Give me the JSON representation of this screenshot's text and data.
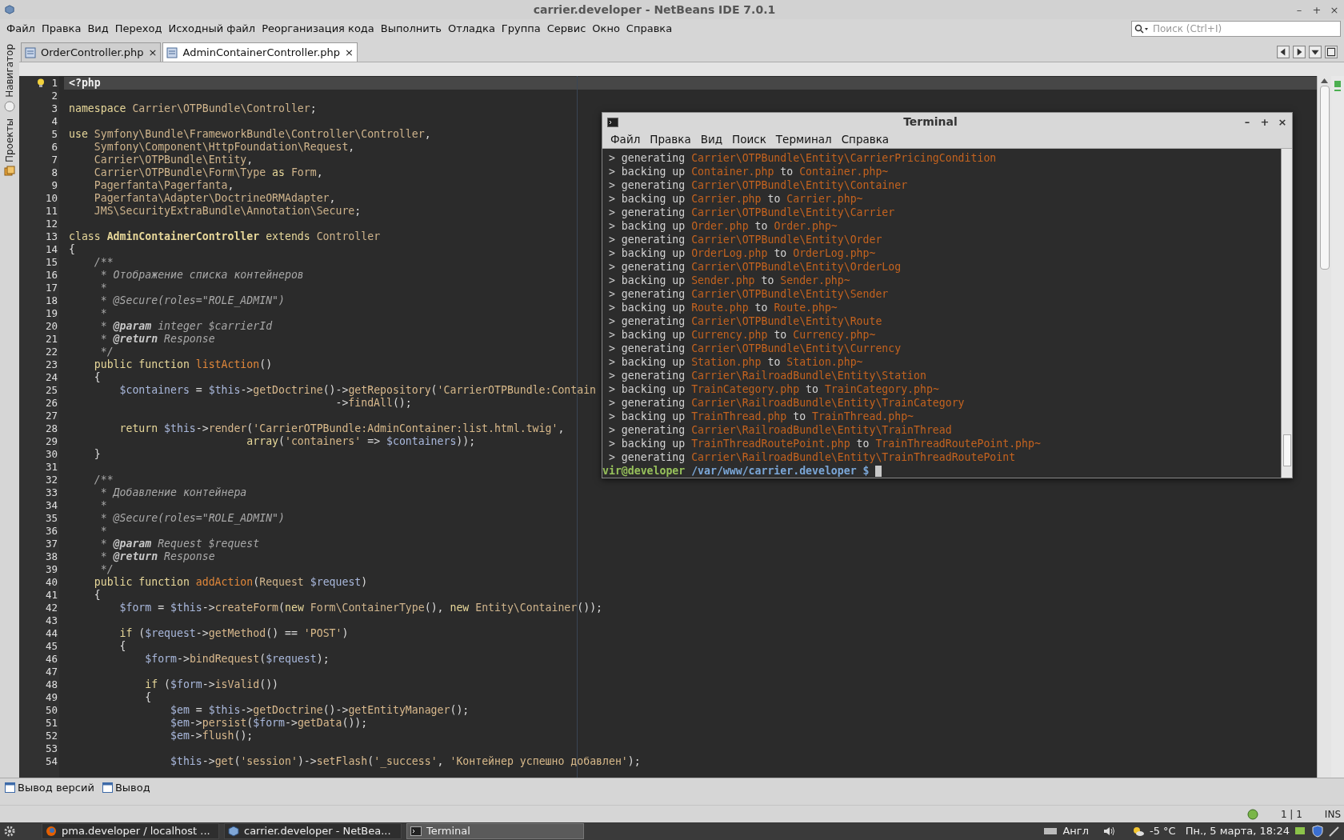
{
  "window": {
    "title": "carrier.developer - NetBeans IDE 7.0.1",
    "controls": [
      "–",
      "+",
      "×"
    ]
  },
  "menu": [
    "Файл",
    "Правка",
    "Вид",
    "Переход",
    "Исходный файл",
    "Реорганизация кода",
    "Выполнить",
    "Отладка",
    "Группа",
    "Сервис",
    "Окно",
    "Справка"
  ],
  "search": {
    "placeholder": "Поиск (Ctrl+I)"
  },
  "tabs": [
    {
      "label": "OrderController.php",
      "selected": false,
      "close": "×"
    },
    {
      "label": "AdminContainerController.php",
      "selected": true,
      "close": "×"
    }
  ],
  "side_panels": [
    "Навигатор",
    "Проекты"
  ],
  "editor": {
    "lines": [
      {
        "n": "1",
        "current": true,
        "tokens": [
          {
            "kind": "php",
            "text": "<?php"
          }
        ]
      },
      {
        "n": "2",
        "current": false
      },
      {
        "n": "3",
        "current": false,
        "tokens": [
          {
            "kind": "kw",
            "text": "namespace "
          },
          {
            "kind": "ns",
            "text": "Carrier\\OTPBundle\\Controller"
          },
          {
            "kind": "pl",
            "text": ";"
          }
        ]
      },
      {
        "n": "4",
        "current": false
      },
      {
        "n": "5",
        "current": false,
        "tokens": [
          {
            "kind": "kw",
            "text": "use "
          },
          {
            "kind": "ns",
            "text": "Symfony\\Bundle\\FrameworkBundle\\Controller\\Controller"
          },
          {
            "kind": "pl",
            "text": ","
          }
        ]
      },
      {
        "n": "6",
        "current": false,
        "tokens": [
          {
            "kind": "ns",
            "text": "    Symfony\\Component\\HttpFoundation\\Request"
          },
          {
            "kind": "pl",
            "text": ","
          }
        ]
      },
      {
        "n": "7",
        "current": false,
        "tokens": [
          {
            "kind": "ns",
            "text": "    Carrier\\OTPBundle\\Entity"
          },
          {
            "kind": "pl",
            "text": ","
          }
        ]
      },
      {
        "n": "8",
        "current": false,
        "tokens": [
          {
            "kind": "ns",
            "text": "    Carrier\\OTPBundle\\Form\\Type"
          },
          {
            "kind": "kw",
            "text": " as "
          },
          {
            "kind": "ns",
            "text": "Form"
          },
          {
            "kind": "pl",
            "text": ","
          }
        ]
      },
      {
        "n": "9",
        "current": false,
        "tokens": [
          {
            "kind": "ns",
            "text": "    Pagerfanta\\Pagerfanta"
          },
          {
            "kind": "pl",
            "text": ","
          }
        ]
      },
      {
        "n": "10",
        "current": false,
        "tokens": [
          {
            "kind": "ns",
            "text": "    Pagerfanta\\Adapter\\DoctrineORMAdapter"
          },
          {
            "kind": "pl",
            "text": ","
          }
        ]
      },
      {
        "n": "11",
        "current": false,
        "tokens": [
          {
            "kind": "ns",
            "text": "    JMS\\SecurityExtraBundle\\Annotation\\Secure"
          },
          {
            "kind": "pl",
            "text": ";"
          }
        ]
      },
      {
        "n": "12",
        "current": false
      },
      {
        "n": "13",
        "current": false,
        "tokens": [
          {
            "kind": "kw",
            "text": "class "
          },
          {
            "kind": "cls",
            "text": "AdminContainerController"
          },
          {
            "kind": "kw",
            "text": " extends "
          },
          {
            "kind": "ns",
            "text": "Controller"
          }
        ]
      },
      {
        "n": "14",
        "current": false,
        "tokens": [
          {
            "kind": "pl",
            "text": "{"
          }
        ]
      },
      {
        "n": "15",
        "current": false,
        "tokens": [
          {
            "kind": "cm",
            "text": "    /**"
          }
        ]
      },
      {
        "n": "16",
        "current": false,
        "tokens": [
          {
            "kind": "cm",
            "text": "     * Отображение списка контейнеров"
          }
        ]
      },
      {
        "n": "17",
        "current": false,
        "tokens": [
          {
            "kind": "cm",
            "text": "     *"
          }
        ]
      },
      {
        "n": "18",
        "current": false,
        "tokens": [
          {
            "kind": "cm",
            "text": "     * @Secure(roles=\"ROLE_ADMIN\")"
          }
        ]
      },
      {
        "n": "19",
        "current": false,
        "tokens": [
          {
            "kind": "cm",
            "text": "     *"
          }
        ]
      },
      {
        "n": "20",
        "current": false,
        "tokens": [
          {
            "kind": "cm",
            "text": "     * "
          },
          {
            "kind": "tag",
            "text": "@param"
          },
          {
            "kind": "cm",
            "text": " integer $carrierId"
          }
        ]
      },
      {
        "n": "21",
        "current": false,
        "tokens": [
          {
            "kind": "cm",
            "text": "     * "
          },
          {
            "kind": "tag",
            "text": "@return"
          },
          {
            "kind": "cm",
            "text": " Response"
          }
        ]
      },
      {
        "n": "22",
        "current": false,
        "tokens": [
          {
            "kind": "cm",
            "text": "     */"
          }
        ]
      },
      {
        "n": "23",
        "current": false,
        "tokens": [
          {
            "kind": "kw",
            "text": "    public function "
          },
          {
            "kind": "def",
            "text": "listAction"
          },
          {
            "kind": "pl",
            "text": "()"
          }
        ]
      },
      {
        "n": "24",
        "current": false,
        "tokens": [
          {
            "kind": "pl",
            "text": "    {"
          }
        ]
      },
      {
        "n": "25",
        "current": false,
        "tokens": [
          {
            "kind": "var",
            "text": "        $containers"
          },
          {
            "kind": "pl",
            "text": " = "
          },
          {
            "kind": "var",
            "text": "$this"
          },
          {
            "kind": "pl",
            "text": "->"
          },
          {
            "kind": "fn",
            "text": "getDoctrine"
          },
          {
            "kind": "pl",
            "text": "()->"
          },
          {
            "kind": "fn",
            "text": "getRepository"
          },
          {
            "kind": "pl",
            "text": "("
          },
          {
            "kind": "str",
            "text": "'CarrierOTPBundle:Contain"
          }
        ]
      },
      {
        "n": "26",
        "current": false,
        "tokens": [
          {
            "kind": "pl",
            "text": "                                          ->"
          },
          {
            "kind": "fn",
            "text": "findAll"
          },
          {
            "kind": "pl",
            "text": "();"
          }
        ]
      },
      {
        "n": "27",
        "current": false
      },
      {
        "n": "28",
        "current": false,
        "tokens": [
          {
            "kind": "kw",
            "text": "        return "
          },
          {
            "kind": "var",
            "text": "$this"
          },
          {
            "kind": "pl",
            "text": "->"
          },
          {
            "kind": "fn",
            "text": "render"
          },
          {
            "kind": "pl",
            "text": "("
          },
          {
            "kind": "str",
            "text": "'CarrierOTPBundle:AdminContainer:list.html.twig'"
          },
          {
            "kind": "pl",
            "text": ","
          }
        ]
      },
      {
        "n": "29",
        "current": false,
        "tokens": [
          {
            "kind": "kw",
            "text": "                            array"
          },
          {
            "kind": "pl",
            "text": "("
          },
          {
            "kind": "str",
            "text": "'containers'"
          },
          {
            "kind": "pl",
            "text": " => "
          },
          {
            "kind": "var",
            "text": "$containers"
          },
          {
            "kind": "pl",
            "text": "));"
          }
        ]
      },
      {
        "n": "30",
        "current": false,
        "tokens": [
          {
            "kind": "pl",
            "text": "    }"
          }
        ]
      },
      {
        "n": "31",
        "current": false
      },
      {
        "n": "32",
        "current": false,
        "tokens": [
          {
            "kind": "cm",
            "text": "    /**"
          }
        ]
      },
      {
        "n": "33",
        "current": false,
        "tokens": [
          {
            "kind": "cm",
            "text": "     * Добавление контейнера"
          }
        ]
      },
      {
        "n": "34",
        "current": false,
        "tokens": [
          {
            "kind": "cm",
            "text": "     *"
          }
        ]
      },
      {
        "n": "35",
        "current": false,
        "tokens": [
          {
            "kind": "cm",
            "text": "     * @Secure(roles=\"ROLE_ADMIN\")"
          }
        ]
      },
      {
        "n": "36",
        "current": false,
        "tokens": [
          {
            "kind": "cm",
            "text": "     *"
          }
        ]
      },
      {
        "n": "37",
        "current": false,
        "tokens": [
          {
            "kind": "cm",
            "text": "     * "
          },
          {
            "kind": "tag",
            "text": "@param"
          },
          {
            "kind": "cm",
            "text": " Request $request"
          }
        ]
      },
      {
        "n": "38",
        "current": false,
        "tokens": [
          {
            "kind": "cm",
            "text": "     * "
          },
          {
            "kind": "tag",
            "text": "@return"
          },
          {
            "kind": "cm",
            "text": " Response"
          }
        ]
      },
      {
        "n": "39",
        "current": false,
        "tokens": [
          {
            "kind": "cm",
            "text": "     */"
          }
        ]
      },
      {
        "n": "40",
        "current": false,
        "tokens": [
          {
            "kind": "kw",
            "text": "    public function "
          },
          {
            "kind": "def",
            "text": "addAction"
          },
          {
            "kind": "pl",
            "text": "("
          },
          {
            "kind": "ns",
            "text": "Request "
          },
          {
            "kind": "var",
            "text": "$request"
          },
          {
            "kind": "pl",
            "text": ")"
          }
        ]
      },
      {
        "n": "41",
        "current": false,
        "tokens": [
          {
            "kind": "pl",
            "text": "    {"
          }
        ]
      },
      {
        "n": "42",
        "current": false,
        "tokens": [
          {
            "kind": "var",
            "text": "        $form"
          },
          {
            "kind": "pl",
            "text": " = "
          },
          {
            "kind": "var",
            "text": "$this"
          },
          {
            "kind": "pl",
            "text": "->"
          },
          {
            "kind": "fn",
            "text": "createForm"
          },
          {
            "kind": "pl",
            "text": "("
          },
          {
            "kind": "kw",
            "text": "new "
          },
          {
            "kind": "ns",
            "text": "Form\\ContainerType"
          },
          {
            "kind": "pl",
            "text": "(), "
          },
          {
            "kind": "kw",
            "text": "new "
          },
          {
            "kind": "ns",
            "text": "Entity\\Container"
          },
          {
            "kind": "pl",
            "text": "());"
          }
        ]
      },
      {
        "n": "43",
        "current": false
      },
      {
        "n": "44",
        "current": false,
        "tokens": [
          {
            "kind": "kw",
            "text": "        if "
          },
          {
            "kind": "pl",
            "text": "("
          },
          {
            "kind": "var",
            "text": "$request"
          },
          {
            "kind": "pl",
            "text": "->"
          },
          {
            "kind": "fn",
            "text": "getMethod"
          },
          {
            "kind": "pl",
            "text": "() == "
          },
          {
            "kind": "str",
            "text": "'POST'"
          },
          {
            "kind": "pl",
            "text": ")"
          }
        ]
      },
      {
        "n": "45",
        "current": false,
        "tokens": [
          {
            "kind": "pl",
            "text": "        {"
          }
        ]
      },
      {
        "n": "46",
        "current": false,
        "tokens": [
          {
            "kind": "var",
            "text": "            $form"
          },
          {
            "kind": "pl",
            "text": "->"
          },
          {
            "kind": "fn",
            "text": "bindRequest"
          },
          {
            "kind": "pl",
            "text": "("
          },
          {
            "kind": "var",
            "text": "$request"
          },
          {
            "kind": "pl",
            "text": ");"
          }
        ]
      },
      {
        "n": "47",
        "current": false
      },
      {
        "n": "48",
        "current": false,
        "tokens": [
          {
            "kind": "kw",
            "text": "            if "
          },
          {
            "kind": "pl",
            "text": "("
          },
          {
            "kind": "var",
            "text": "$form"
          },
          {
            "kind": "pl",
            "text": "->"
          },
          {
            "kind": "fn",
            "text": "isValid"
          },
          {
            "kind": "pl",
            "text": "())"
          }
        ]
      },
      {
        "n": "49",
        "current": false,
        "tokens": [
          {
            "kind": "pl",
            "text": "            {"
          }
        ]
      },
      {
        "n": "50",
        "current": false,
        "tokens": [
          {
            "kind": "var",
            "text": "                $em"
          },
          {
            "kind": "pl",
            "text": " = "
          },
          {
            "kind": "var",
            "text": "$this"
          },
          {
            "kind": "pl",
            "text": "->"
          },
          {
            "kind": "fn",
            "text": "getDoctrine"
          },
          {
            "kind": "pl",
            "text": "()->"
          },
          {
            "kind": "fn",
            "text": "getEntityManager"
          },
          {
            "kind": "pl",
            "text": "();"
          }
        ]
      },
      {
        "n": "51",
        "current": false,
        "tokens": [
          {
            "kind": "var",
            "text": "                $em"
          },
          {
            "kind": "pl",
            "text": "->"
          },
          {
            "kind": "fn",
            "text": "persist"
          },
          {
            "kind": "pl",
            "text": "("
          },
          {
            "kind": "var",
            "text": "$form"
          },
          {
            "kind": "pl",
            "text": "->"
          },
          {
            "kind": "fn",
            "text": "getData"
          },
          {
            "kind": "pl",
            "text": "());"
          }
        ]
      },
      {
        "n": "52",
        "current": false,
        "tokens": [
          {
            "kind": "var",
            "text": "                $em"
          },
          {
            "kind": "pl",
            "text": "->"
          },
          {
            "kind": "fn",
            "text": "flush"
          },
          {
            "kind": "pl",
            "text": "();"
          }
        ]
      },
      {
        "n": "53",
        "current": false
      },
      {
        "n": "54",
        "current": false,
        "tokens": [
          {
            "kind": "var",
            "text": "                $this"
          },
          {
            "kind": "pl",
            "text": "->"
          },
          {
            "kind": "fn",
            "text": "get"
          },
          {
            "kind": "pl",
            "text": "("
          },
          {
            "kind": "str",
            "text": "'session'"
          },
          {
            "kind": "pl",
            "text": ")->"
          },
          {
            "kind": "fn",
            "text": "setFlash"
          },
          {
            "kind": "pl",
            "text": "("
          },
          {
            "kind": "str",
            "text": "'_success'"
          },
          {
            "kind": "pl",
            "text": ", "
          },
          {
            "kind": "str",
            "text": "'Контейнер успешно добавлен'"
          },
          {
            "kind": "pl",
            "text": ");"
          }
        ]
      }
    ]
  },
  "terminal": {
    "title": "Terminal",
    "controls": [
      "–",
      "+",
      "×"
    ],
    "menu": [
      "Файл",
      "Правка",
      "Вид",
      "Поиск",
      "Терминал",
      "Справка"
    ],
    "lines": [
      {
        "kind": "generate",
        "marker": ">",
        "verb": "generating",
        "path": "Carrier\\OTPBundle\\Entity\\CarrierPricingCondition"
      },
      {
        "kind": "backup",
        "marker": ">",
        "verb": "backing up",
        "from": "Container.php",
        "joiner": "to",
        "to": "Container.php~"
      },
      {
        "kind": "generate",
        "marker": ">",
        "verb": "generating",
        "path": "Carrier\\OTPBundle\\Entity\\Container"
      },
      {
        "kind": "backup",
        "marker": ">",
        "verb": "backing up",
        "from": "Carrier.php",
        "joiner": "to",
        "to": "Carrier.php~"
      },
      {
        "kind": "generate",
        "marker": ">",
        "verb": "generating",
        "path": "Carrier\\OTPBundle\\Entity\\Carrier"
      },
      {
        "kind": "backup",
        "marker": ">",
        "verb": "backing up",
        "from": "Order.php",
        "joiner": "to",
        "to": "Order.php~"
      },
      {
        "kind": "generate",
        "marker": ">",
        "verb": "generating",
        "path": "Carrier\\OTPBundle\\Entity\\Order"
      },
      {
        "kind": "backup",
        "marker": ">",
        "verb": "backing up",
        "from": "OrderLog.php",
        "joiner": "to",
        "to": "OrderLog.php~"
      },
      {
        "kind": "generate",
        "marker": ">",
        "verb": "generating",
        "path": "Carrier\\OTPBundle\\Entity\\OrderLog"
      },
      {
        "kind": "backup",
        "marker": ">",
        "verb": "backing up",
        "from": "Sender.php",
        "joiner": "to",
        "to": "Sender.php~"
      },
      {
        "kind": "generate",
        "marker": ">",
        "verb": "generating",
        "path": "Carrier\\OTPBundle\\Entity\\Sender"
      },
      {
        "kind": "backup",
        "marker": ">",
        "verb": "backing up",
        "from": "Route.php",
        "joiner": "to",
        "to": "Route.php~"
      },
      {
        "kind": "generate",
        "marker": ">",
        "verb": "generating",
        "path": "Carrier\\OTPBundle\\Entity\\Route"
      },
      {
        "kind": "backup",
        "marker": ">",
        "verb": "backing up",
        "from": "Currency.php",
        "joiner": "to",
        "to": "Currency.php~"
      },
      {
        "kind": "generate",
        "marker": ">",
        "verb": "generating",
        "path": "Carrier\\OTPBundle\\Entity\\Currency"
      },
      {
        "kind": "backup",
        "marker": ">",
        "verb": "backing up",
        "from": "Station.php",
        "joiner": "to",
        "to": "Station.php~"
      },
      {
        "kind": "generate",
        "marker": ">",
        "verb": "generating",
        "path": "Carrier\\RailroadBundle\\Entity\\Station"
      },
      {
        "kind": "backup",
        "marker": ">",
        "verb": "backing up",
        "from": "TrainCategory.php",
        "joiner": "to",
        "to": "TrainCategory.php~"
      },
      {
        "kind": "generate",
        "marker": ">",
        "verb": "generating",
        "path": "Carrier\\RailroadBundle\\Entity\\TrainCategory"
      },
      {
        "kind": "backup",
        "marker": ">",
        "verb": "backing up",
        "from": "TrainThread.php",
        "joiner": "to",
        "to": "TrainThread.php~"
      },
      {
        "kind": "generate",
        "marker": ">",
        "verb": "generating",
        "path": "Carrier\\RailroadBundle\\Entity\\TrainThread"
      },
      {
        "kind": "backup",
        "marker": ">",
        "verb": "backing up",
        "from": "TrainThreadRoutePoint.php",
        "joiner": "to",
        "to": "TrainThreadRoutePoint.php~"
      },
      {
        "kind": "generate",
        "marker": ">",
        "verb": "generating",
        "path": "Carrier\\RailroadBundle\\Entity\\TrainThreadRoutePoint"
      }
    ],
    "prompt": {
      "user": "vir@developer",
      "path": "/var/www/carrier.developer",
      "symbol": "$"
    }
  },
  "output_tabs": [
    "Вывод версий",
    "Вывод"
  ],
  "status_bar": {
    "position": "1 | 1",
    "mode": "INS"
  },
  "taskbar": {
    "items": [
      {
        "label": "pma.developer / localhost ...",
        "kind": "browser",
        "selected": false
      },
      {
        "label": "carrier.developer - NetBea...",
        "kind": "ide",
        "selected": false
      },
      {
        "label": "Terminal",
        "kind": "terminal",
        "selected": true
      }
    ],
    "keyboard": "Англ",
    "weather": "-5 °C",
    "clock": "Пн., 5 марта, 18:24"
  }
}
